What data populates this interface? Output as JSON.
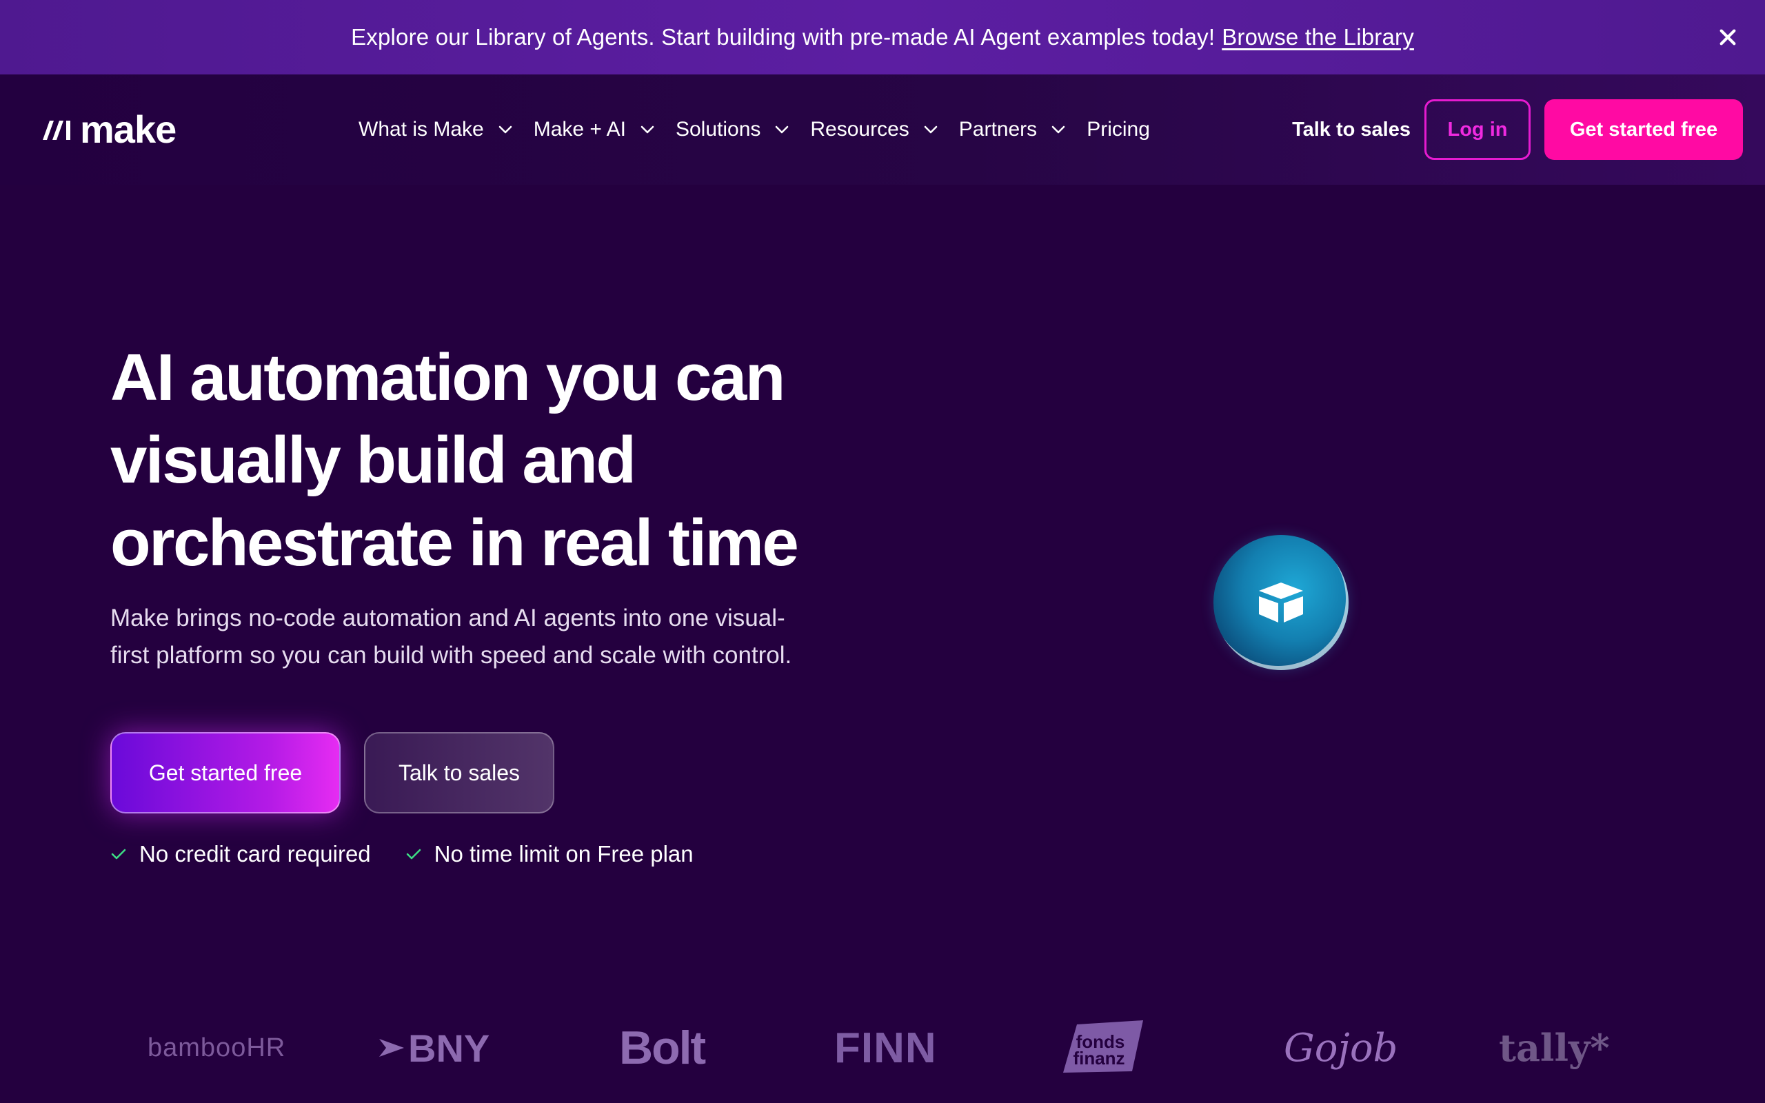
{
  "banner": {
    "message": "Explore our Library of Agents. Start building with pre-made AI Agent examples today!",
    "link_label": "Browse the Library",
    "close_icon": "close-icon"
  },
  "nav": {
    "logo_text": "make",
    "menu": [
      {
        "label": "What is Make",
        "has_dropdown": true
      },
      {
        "label": "Make + AI",
        "has_dropdown": true
      },
      {
        "label": "Solutions",
        "has_dropdown": true
      },
      {
        "label": "Resources",
        "has_dropdown": true
      },
      {
        "label": "Partners",
        "has_dropdown": true
      },
      {
        "label": "Pricing",
        "has_dropdown": false
      }
    ],
    "talk_to_sales": "Talk to sales",
    "login": "Log in",
    "get_started": "Get started free"
  },
  "hero": {
    "title_lines": [
      "AI automation you can",
      "visually build and",
      "orchestrate in real time"
    ],
    "subtitle_lines": [
      "Make brings no-code automation and AI agents into one visual-",
      "first platform so you can build with speed and scale with control."
    ],
    "cta_primary": "Get started free",
    "cta_secondary": "Talk to sales",
    "checks": [
      "No credit card required",
      "No time limit on Free plan"
    ],
    "app_bubble_icon": "airtable-icon"
  },
  "logos": {
    "bamboohr": "bambooHR",
    "bny": "BNY",
    "bolt": "Bolt",
    "finn": "FINN",
    "fonds_line1": "fonds",
    "fonds_line2": "finanz",
    "gojob": "Gojob",
    "tally": "tally*"
  },
  "colors": {
    "background": "#24003f",
    "banner": "#5c1ea2",
    "accent_pink": "#ff0aa3",
    "login_border": "#e61bd0",
    "check_green": "#3ddc84"
  }
}
